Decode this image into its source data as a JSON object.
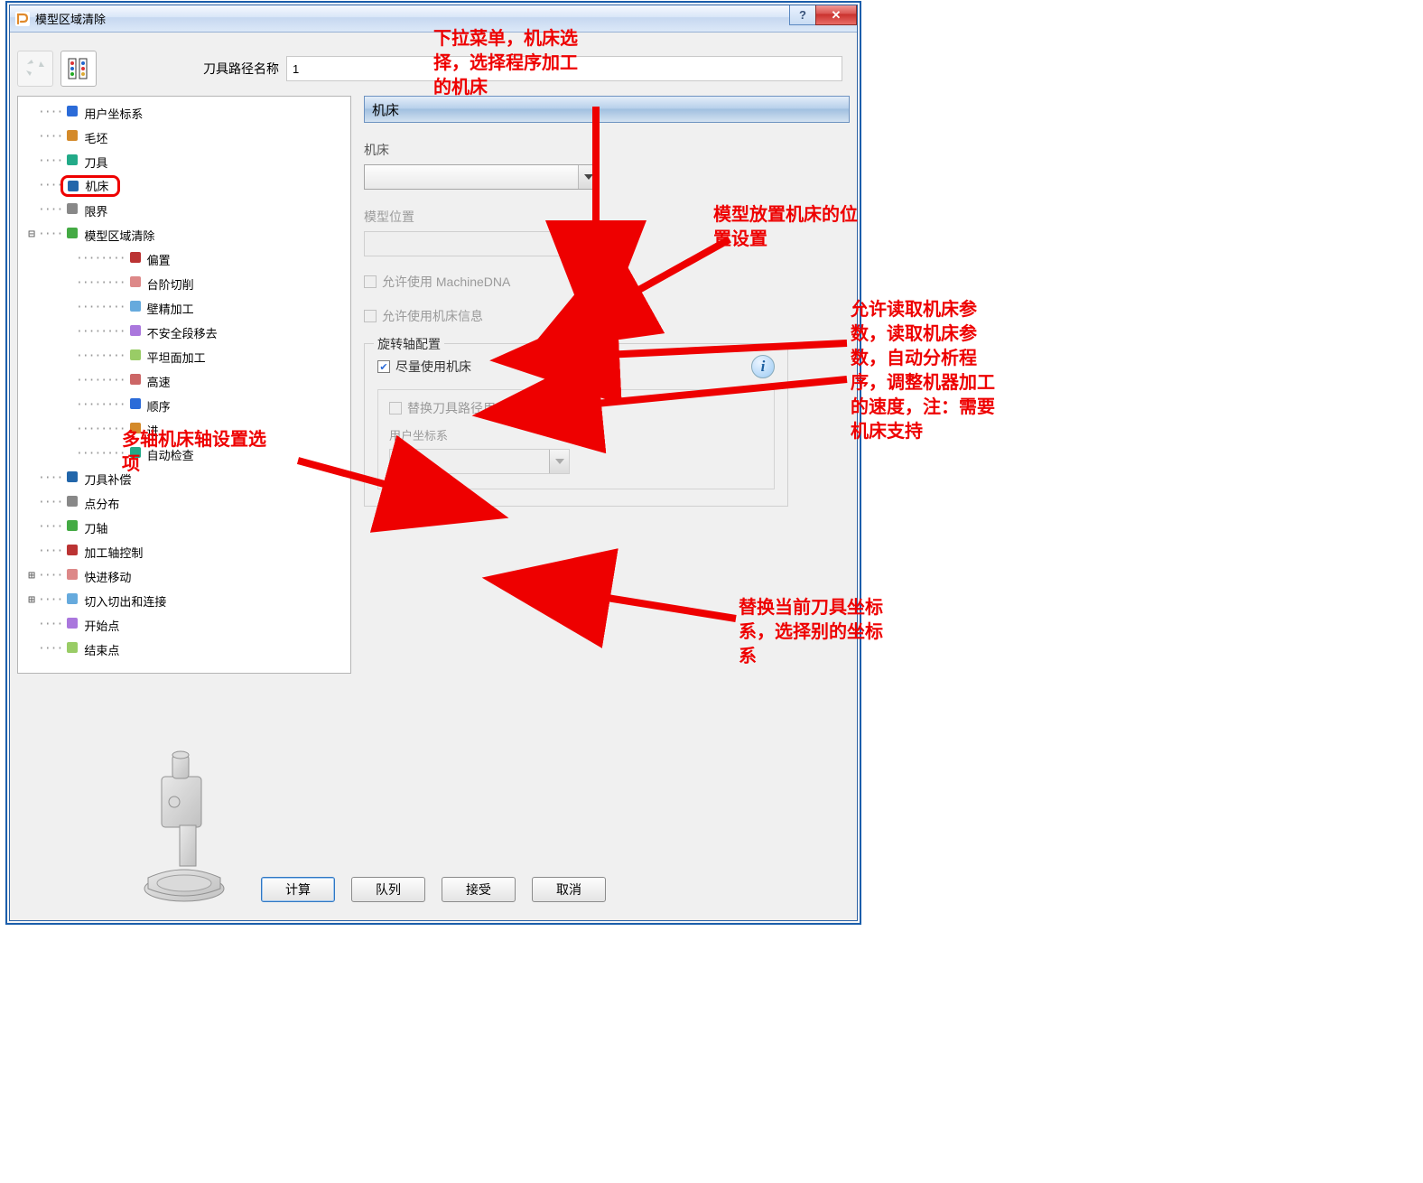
{
  "window": {
    "title": "模型区域清除",
    "help_btn": "?",
    "close_btn": "✕"
  },
  "toolbar": {
    "path_name_label": "刀具路径名称",
    "path_name_value": "1"
  },
  "tree": {
    "items": [
      {
        "label": "用户坐标系",
        "level": 1
      },
      {
        "label": "毛坯",
        "level": 1
      },
      {
        "label": "刀具",
        "level": 1
      },
      {
        "label": "机床",
        "level": 1,
        "highlight": true
      },
      {
        "label": "限界",
        "level": 1
      },
      {
        "label": "模型区域清除",
        "level": 1,
        "expander": "⊟"
      },
      {
        "label": "偏置",
        "level": 2
      },
      {
        "label": "台阶切削",
        "level": 2
      },
      {
        "label": "壁精加工",
        "level": 2
      },
      {
        "label": "不安全段移去",
        "level": 2
      },
      {
        "label": "平坦面加工",
        "level": 2
      },
      {
        "label": "高速",
        "level": 2
      },
      {
        "label": "顺序",
        "level": 2
      },
      {
        "label": "进",
        "level": 2
      },
      {
        "label": "自动检查",
        "level": 2
      },
      {
        "label": "刀具补偿",
        "level": 1
      },
      {
        "label": "点分布",
        "level": 1
      },
      {
        "label": "刀轴",
        "level": 1
      },
      {
        "label": "加工轴控制",
        "level": 1
      },
      {
        "label": "快进移动",
        "level": 1,
        "expander": "⊞"
      },
      {
        "label": "切入切出和连接",
        "level": 1,
        "expander": "⊞"
      },
      {
        "label": "开始点",
        "level": 1
      },
      {
        "label": "结束点",
        "level": 1
      }
    ]
  },
  "panel": {
    "header": "机床",
    "machine_label": "机床",
    "model_pos_label": "模型位置",
    "allow_dna_label": "允许使用 MachineDNA",
    "allow_info_label": "允许使用机床信息",
    "rotary_group": "旋转轴配置",
    "prefer_machine_label": "尽量使用机床",
    "replace_wcs_label": "替换刀具路径用户坐标系",
    "user_wcs_label": "用户坐标系",
    "info_btn": "i"
  },
  "buttons": {
    "calc": "计算",
    "queue": "队列",
    "accept": "接受",
    "cancel": "取消"
  },
  "annotations": {
    "a1": "下拉菜单，机床选\n择，选择程序加工\n的机床",
    "a2": "模型放置机床的位\n置设置",
    "a3": "允许读取机床参\n数，读取机床参\n数，自动分析程\n序，调整机器加工\n的速度，注：需要\n机床支持",
    "a4": "替换当前刀具坐标\n系，选择别的坐标\n系",
    "a5": "多轴机床轴设置选\n项"
  },
  "colors": {
    "annotation": "#ee0000",
    "title_bg_start": "#f6f9fe",
    "title_bg_end": "#c6d8f0"
  }
}
